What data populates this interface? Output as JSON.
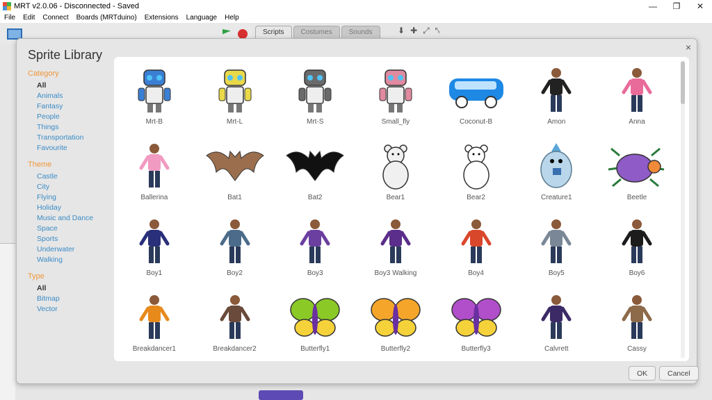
{
  "window": {
    "title": "MRT v2.0.06 - Disconnected - Saved",
    "controls": [
      "—",
      "❐",
      "✕"
    ]
  },
  "menu": [
    "File",
    "Edit",
    "Connect",
    "Boards (MRTduino)",
    "Extensions",
    "Language",
    "Help"
  ],
  "tabs": [
    "Scripts",
    "Costumes",
    "Sounds"
  ],
  "tools": [
    "⬇",
    "✚",
    "⤢",
    "⤣"
  ],
  "dialog": {
    "title": "Sprite Library",
    "close": "×",
    "ok": "OK",
    "cancel": "Cancel"
  },
  "sidebar": {
    "category": {
      "title": "Category",
      "items": [
        "All",
        "Animals",
        "Fantasy",
        "People",
        "Things",
        "Transportation",
        "Favourite"
      ],
      "selected": 0
    },
    "theme": {
      "title": "Theme",
      "items": [
        "Castle",
        "City",
        "Flying",
        "Holiday",
        "Music and Dance",
        "Space",
        "Sports",
        "Underwater",
        "Walking"
      ]
    },
    "type": {
      "title": "Type",
      "items": [
        "All",
        "Bitmap",
        "Vector"
      ],
      "selected": 0
    }
  },
  "sprites": [
    {
      "name": "Mrt-B",
      "icon": "robot-icon",
      "color": "#3b7fd4"
    },
    {
      "name": "Mrt-L",
      "icon": "robot-icon",
      "color": "#e9d94a"
    },
    {
      "name": "Mrt-S",
      "icon": "robot-icon",
      "color": "#6a6a6a"
    },
    {
      "name": "Small_fly",
      "icon": "robot-icon",
      "color": "#e08aa0"
    },
    {
      "name": "Coconut-B",
      "icon": "vehicle-icon",
      "color": "#1e88e5"
    },
    {
      "name": "Amon",
      "icon": "person-icon",
      "color": "#222222"
    },
    {
      "name": "Anna",
      "icon": "person-icon",
      "color": "#e86b9a"
    },
    {
      "name": "Ballerina",
      "icon": "person-icon",
      "color": "#f19ac2"
    },
    {
      "name": "Bat1",
      "icon": "bat-icon",
      "color": "#9b6f4d"
    },
    {
      "name": "Bat2",
      "icon": "bat-icon",
      "color": "#111111"
    },
    {
      "name": "Bear1",
      "icon": "bear-icon",
      "color": "#f0f0f0"
    },
    {
      "name": "Bear2",
      "icon": "bear-icon",
      "color": "#ffffff"
    },
    {
      "name": "Creature1",
      "icon": "creature-icon",
      "color": "#b9d6ea"
    },
    {
      "name": "Beetle",
      "icon": "beetle-icon",
      "color": "#8e5bc7"
    },
    {
      "name": "Boy1",
      "icon": "person-icon",
      "color": "#2a2f7a"
    },
    {
      "name": "Boy2",
      "icon": "person-icon",
      "color": "#4c6b8a"
    },
    {
      "name": "Boy3",
      "icon": "person-icon",
      "color": "#6b3fa0"
    },
    {
      "name": "Boy3 Walking",
      "icon": "person-icon",
      "color": "#5a2e8a"
    },
    {
      "name": "Boy4",
      "icon": "person-icon",
      "color": "#d9472b"
    },
    {
      "name": "Boy5",
      "icon": "person-icon",
      "color": "#7a8796"
    },
    {
      "name": "Boy6",
      "icon": "person-icon",
      "color": "#1c1c1c"
    },
    {
      "name": "Breakdancer1",
      "icon": "person-icon",
      "color": "#e8891c"
    },
    {
      "name": "Breakdancer2",
      "icon": "person-icon",
      "color": "#6a4a3a"
    },
    {
      "name": "Butterfly1",
      "icon": "butterfly-icon",
      "color": "#8ac926"
    },
    {
      "name": "Butterfly2",
      "icon": "butterfly-icon",
      "color": "#f4a52a"
    },
    {
      "name": "Butterfly3",
      "icon": "butterfly-icon",
      "color": "#b04fc9"
    },
    {
      "name": "Calvrett",
      "icon": "person-icon",
      "color": "#3b2a66"
    },
    {
      "name": "Cassy",
      "icon": "person-icon",
      "color": "#8d6a4a"
    }
  ]
}
